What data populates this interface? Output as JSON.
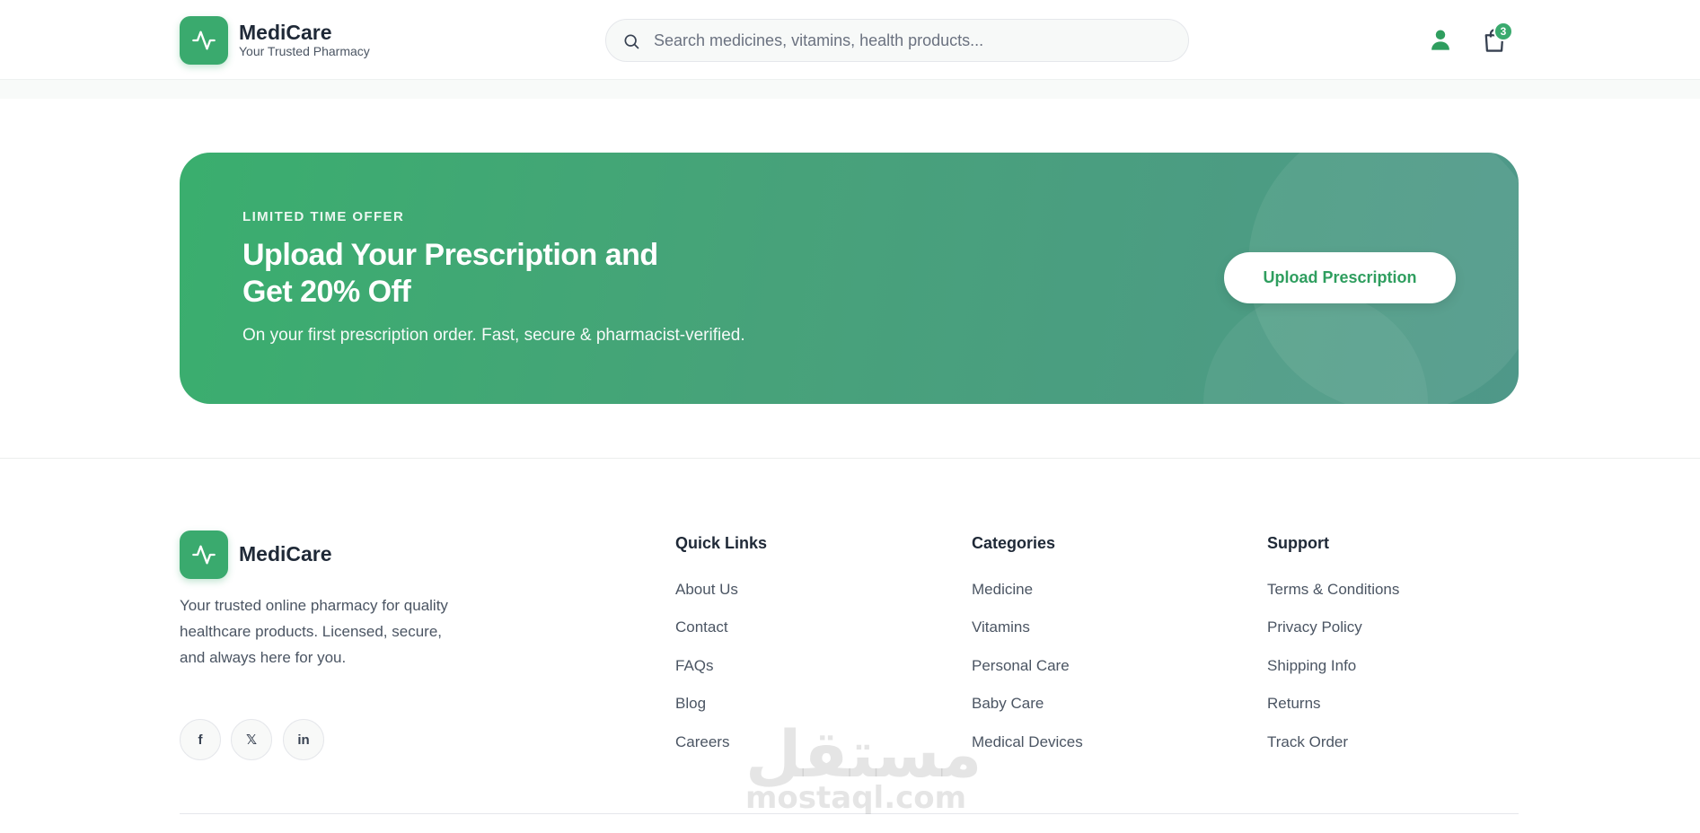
{
  "header": {
    "brand_name": "MediCare",
    "brand_tagline": "Your Trusted Pharmacy",
    "search_placeholder": "Search medicines, vitamins, health products...",
    "cart_count": "3"
  },
  "banner": {
    "eyebrow": "LIMITED TIME OFFER",
    "title": "Upload Your Prescription and Get 20% Off",
    "subtitle": "On your first prescription order. Fast, secure & pharmacist-verified.",
    "button_label": "Upload Prescription"
  },
  "footer": {
    "brand_name": "MediCare",
    "description": "Your trusted online pharmacy for quality healthcare products. Licensed, secure, and always here for you.",
    "social": [
      {
        "label": "f",
        "icon": "facebook-icon"
      },
      {
        "label": "𝕏",
        "icon": "x-icon"
      },
      {
        "label": "in",
        "icon": "linkedin-icon"
      }
    ],
    "columns": [
      {
        "title": "Quick Links",
        "links": [
          "About Us",
          "Contact",
          "FAQs",
          "Blog",
          "Careers"
        ]
      },
      {
        "title": "Categories",
        "links": [
          "Medicine",
          "Vitamins",
          "Personal Care",
          "Baby Care",
          "Medical Devices"
        ]
      },
      {
        "title": "Support",
        "links": [
          "Terms & Conditions",
          "Privacy Policy",
          "Shipping Info",
          "Returns",
          "Track Order"
        ]
      }
    ]
  },
  "watermark": {
    "arabic": "مستقل",
    "latin": "mostaql.com"
  },
  "colors": {
    "brand": "#3aaa6e",
    "text": "#1f2937",
    "muted": "#4b5563"
  }
}
